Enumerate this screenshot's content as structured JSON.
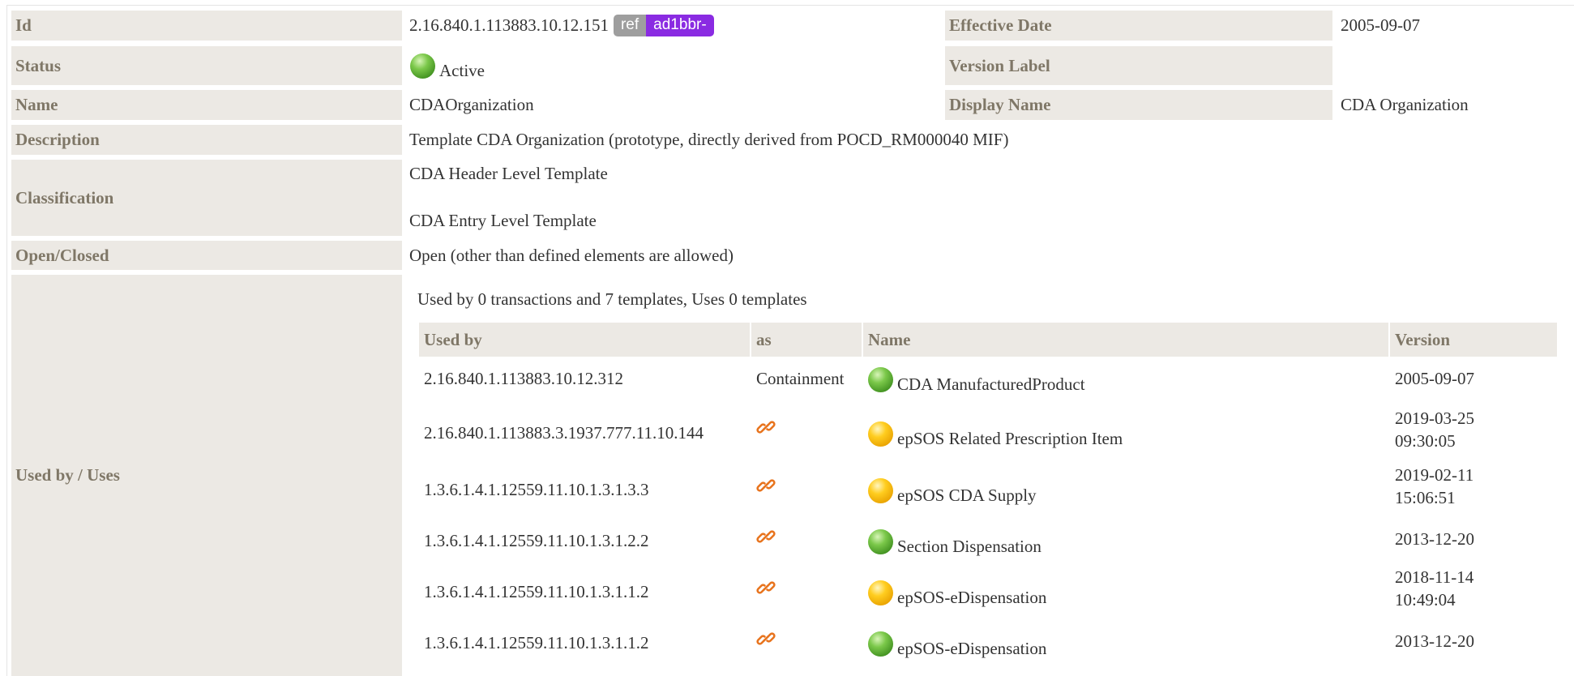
{
  "rows": {
    "id": {
      "label": "Id",
      "value": "2.16.840.1.113883.10.12.151",
      "ref_badge": "ref",
      "id_badge": "ad1bbr-"
    },
    "effective_date": {
      "label": "Effective Date",
      "value": "2005-09-07"
    },
    "status": {
      "label": "Status",
      "value": "Active",
      "status_color": "green"
    },
    "version_label": {
      "label": "Version Label",
      "value": ""
    },
    "name": {
      "label": "Name",
      "value": "CDAOrganization"
    },
    "display_name": {
      "label": "Display Name",
      "value": "CDA Organization"
    },
    "description": {
      "label": "Description",
      "value": "Template CDA Organization (prototype, directly derived from POCD_RM000040 MIF)"
    },
    "classification": {
      "label": "Classification",
      "values": [
        "CDA Header Level Template",
        "CDA Entry Level Template"
      ]
    },
    "open_closed": {
      "label": "Open/Closed",
      "value": "Open (other than defined elements are allowed)"
    },
    "used_by_uses": {
      "label": "Used by / Uses",
      "summary": "Used by 0 transactions and 7 templates, Uses 0 templates"
    }
  },
  "usage_table": {
    "headers": {
      "used_by": "Used by",
      "as": "as",
      "name": "Name",
      "version": "Version"
    },
    "rows": [
      {
        "used_by": "2.16.840.1.113883.10.12.312",
        "as": "Containment",
        "as_icon": "",
        "status": "green",
        "name": "CDA ManufacturedProduct",
        "version_date": "2005-09-07",
        "version_time": ""
      },
      {
        "used_by": "2.16.840.1.113883.3.1937.777.11.10.144",
        "as": "",
        "as_icon": "link-icon",
        "status": "yellow",
        "name": "epSOS Related Prescription Item",
        "version_date": "2019-03-25",
        "version_time": "09:30:05"
      },
      {
        "used_by": "1.3.6.1.4.1.12559.11.10.1.3.1.3.3",
        "as": "",
        "as_icon": "link-icon",
        "status": "yellow",
        "name": "epSOS CDA Supply",
        "version_date": "2019-02-11",
        "version_time": "15:06:51"
      },
      {
        "used_by": "1.3.6.1.4.1.12559.11.10.1.3.1.2.2",
        "as": "",
        "as_icon": "link-icon",
        "status": "green",
        "name": "Section Dispensation",
        "version_date": "2013-12-20",
        "version_time": ""
      },
      {
        "used_by": "1.3.6.1.4.1.12559.11.10.1.3.1.1.2",
        "as": "",
        "as_icon": "link-icon",
        "status": "yellow",
        "name": "epSOS-eDispensation",
        "version_date": "2018-11-14",
        "version_time": "10:49:04"
      },
      {
        "used_by": "1.3.6.1.4.1.12559.11.10.1.3.1.1.2",
        "as": "",
        "as_icon": "link-icon",
        "status": "green",
        "name": "epSOS-eDispensation",
        "version_date": "2013-12-20",
        "version_time": ""
      }
    ]
  },
  "colors": {
    "label_bg": "#ece9e4",
    "label_text": "#7f7767",
    "ref_badge_bg": "#9e9e9e",
    "id_badge_bg": "#8a2be2",
    "link_icon": "#e8741e"
  }
}
